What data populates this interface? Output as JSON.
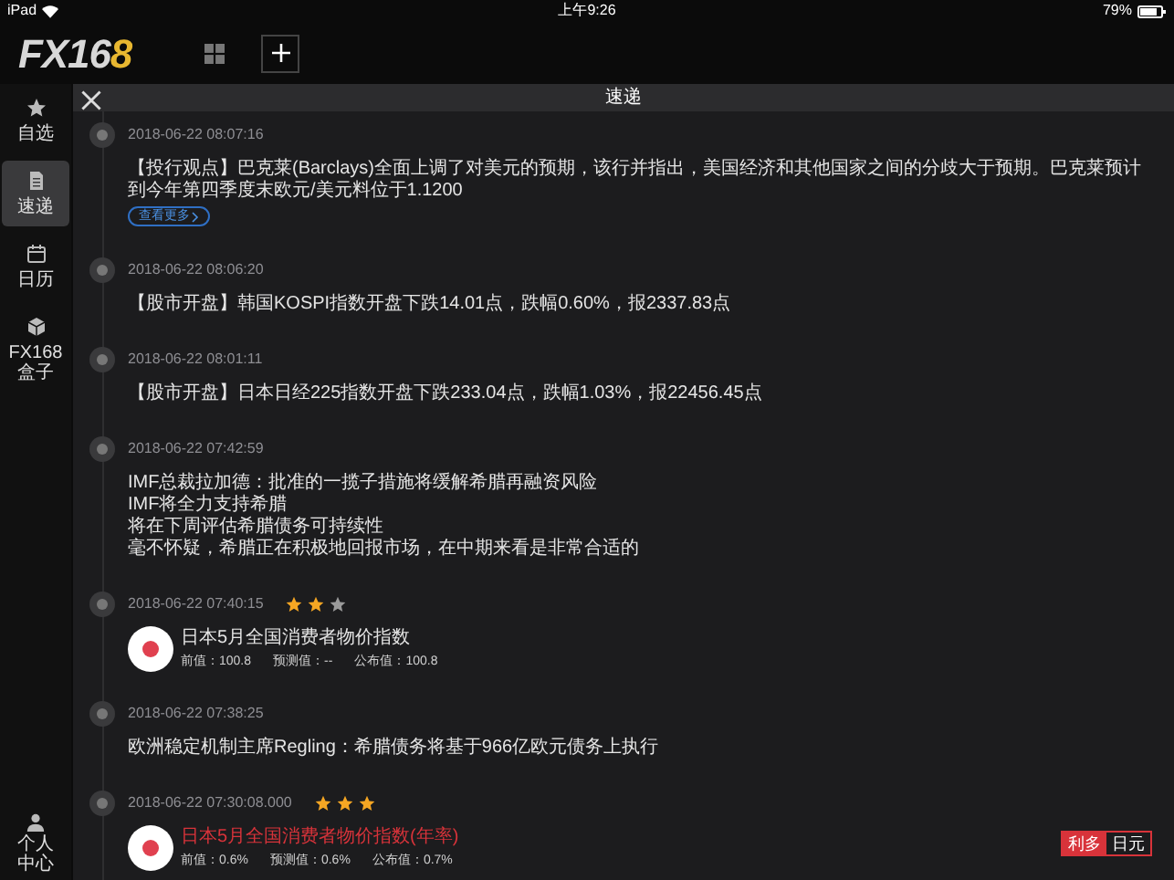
{
  "status_bar": {
    "device": "iPad",
    "time": "上午9:26",
    "battery": "79%"
  },
  "header": {
    "logo": "FX168"
  },
  "sidebar": {
    "items": [
      {
        "label": "自选",
        "kind": "star",
        "selected": false
      },
      {
        "label": "速递",
        "kind": "doc",
        "selected": true
      },
      {
        "label": "日历",
        "kind": "calendar",
        "selected": false
      },
      {
        "label": "FX168 盒子",
        "kind": "box",
        "selected": false
      }
    ],
    "bottom": {
      "label": "个人中心"
    }
  },
  "panel": {
    "title": "速递"
  },
  "feed": [
    {
      "kind": "text",
      "time": "2018-06-22 08:07:16",
      "lines": [
        "【投行观点】巴克莱(Barclays)全面上调了对美元的预期，该行并指出，美国经济和其他国家之间的分歧大于预期。巴克莱预计到今年第四季度末欧元/美元料位于1.1200"
      ],
      "more": "查看更多"
    },
    {
      "kind": "text",
      "time": "2018-06-22 08:06:20",
      "lines": [
        "【股市开盘】韩国KOSPI指数开盘下跌14.01点，跌幅0.60%，报2337.83点"
      ]
    },
    {
      "kind": "text",
      "time": "2018-06-22 08:01:11",
      "lines": [
        "【股市开盘】日本日经225指数开盘下跌233.04点，跌幅1.03%，报22456.45点"
      ]
    },
    {
      "kind": "text",
      "time": "2018-06-22 07:42:59",
      "lines": [
        "IMF总裁拉加德：批准的一揽子措施将缓解希腊再融资风险",
        "IMF将全力支持希腊",
        "将在下周评估希腊债务可持续性",
        "毫不怀疑，希腊正在积极地回报市场，在中期来看是非常合适的"
      ]
    },
    {
      "kind": "data",
      "time": "2018-06-22 07:40:15",
      "stars": 2,
      "title": "日本5月全国消费者物价指数",
      "highlighted": false,
      "values": [
        "前值：100.8",
        "预测值：--",
        "公布值：100.8"
      ]
    },
    {
      "kind": "text",
      "time": "2018-06-22 07:38:25",
      "lines": [
        "欧洲稳定机制主席Regling：希腊债务将基于966亿欧元债务上执行"
      ]
    },
    {
      "kind": "data",
      "time": "2018-06-22 07:30:08.000",
      "stars": 3,
      "title": "日本5月全国消费者物价指数(年率)",
      "highlighted": true,
      "values": [
        "前值：0.6%",
        "预测值：0.6%",
        "公布值：0.7%"
      ],
      "tags": [
        "利多",
        "日元"
      ]
    }
  ]
}
